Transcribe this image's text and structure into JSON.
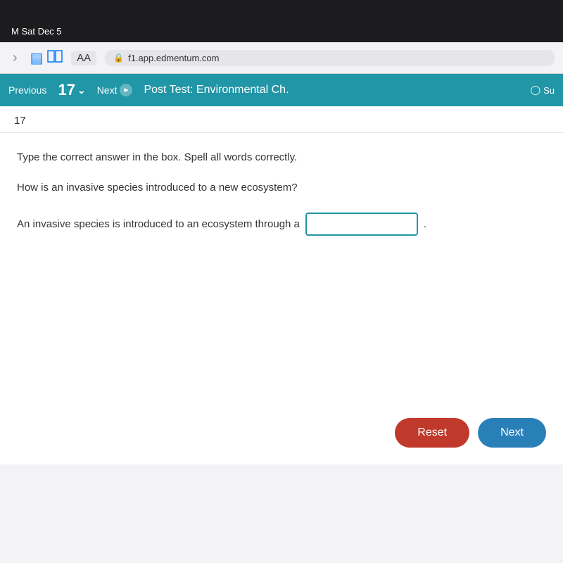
{
  "statusBar": {
    "text": "M  Sat Dec 5"
  },
  "browserToolbar": {
    "aaLabel": "AA",
    "addressText": "f1.app.edmentum.com",
    "lockIcon": "🔒"
  },
  "appNav": {
    "previousLabel": "Previous",
    "questionNumber": "17",
    "nextLabel": "Next",
    "title": "Post Test: Environmental Ch.",
    "statusIcon": "✓",
    "statusText": "Su"
  },
  "question": {
    "number": "17",
    "instruction": "Type the correct answer in the box. Spell all words correctly.",
    "questionText": "How is an invasive species introduced to a new ecosystem?",
    "answerPrefix": "An invasive species is introduced to an ecosystem through a",
    "answerSuffix": ".",
    "answerPlaceholder": "",
    "answerValue": ""
  },
  "buttons": {
    "resetLabel": "Reset",
    "nextLabel": "Next"
  }
}
